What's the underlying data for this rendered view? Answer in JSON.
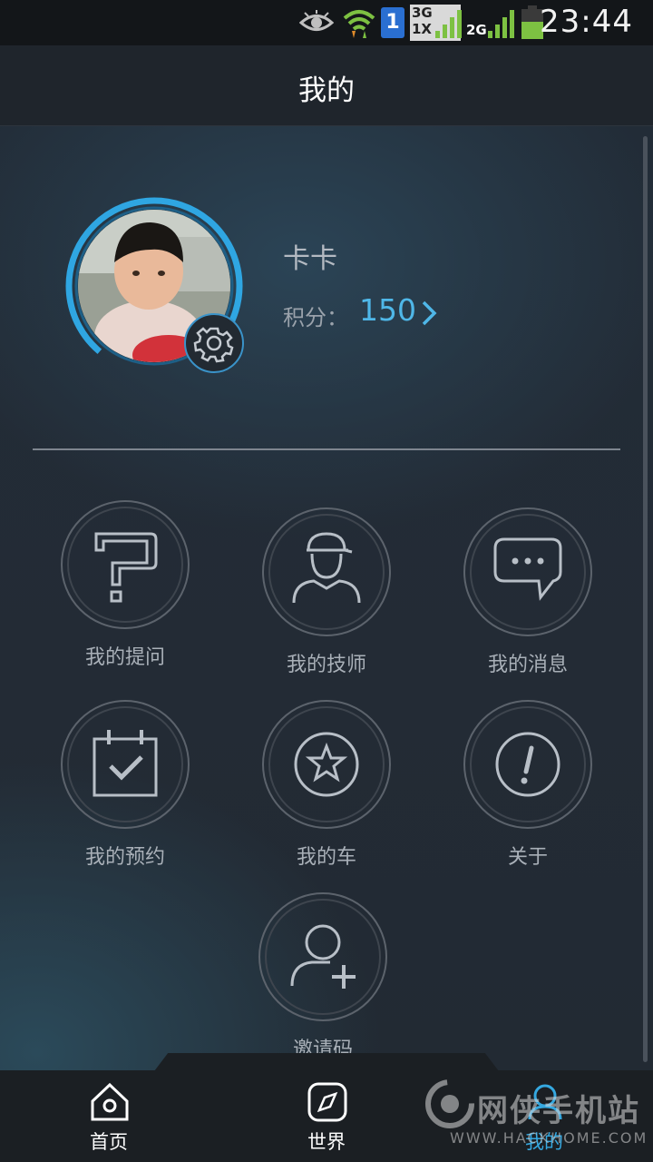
{
  "status_bar": {
    "time": "23:44",
    "sim": "1",
    "network_badge_top": "3G",
    "network_badge_bottom": "1X",
    "network_2g": "2G"
  },
  "header": {
    "title": "我的"
  },
  "profile": {
    "username": "卡卡",
    "points_label": "积分：",
    "points_value": "150"
  },
  "menu": [
    {
      "label": "我的提问",
      "icon": "question-icon"
    },
    {
      "label": "我的技师",
      "icon": "technician-icon"
    },
    {
      "label": "我的消息",
      "icon": "message-icon"
    },
    {
      "label": "我的预约",
      "icon": "calendar-check-icon"
    },
    {
      "label": "我的车",
      "icon": "star-icon"
    },
    {
      "label": "关于",
      "icon": "info-icon"
    },
    {
      "label": "邀请码",
      "icon": "add-user-icon"
    }
  ],
  "tabs": [
    {
      "label": "首页",
      "icon": "home-icon"
    },
    {
      "label": "世界",
      "icon": "compass-icon"
    },
    {
      "label": "我的",
      "icon": "user-icon",
      "active": true
    }
  ],
  "watermark": {
    "text": "网侠手机站",
    "url": "WWW.HACKHOME.COM"
  },
  "colors": {
    "accent": "#35a8e0",
    "background": "#222a33",
    "header": "#1f252c"
  }
}
